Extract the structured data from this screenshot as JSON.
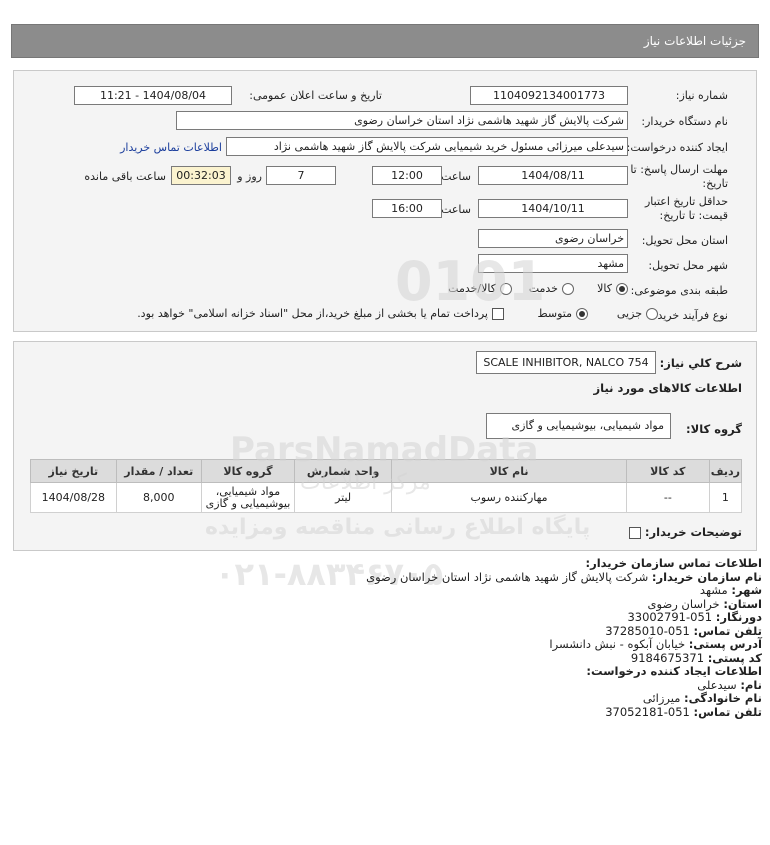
{
  "header": {
    "title": "جزئیات اطلاعات نیاز"
  },
  "form": {
    "need_number_label": "شماره نیاز:",
    "need_number": "1104092134001773",
    "announce_label": "تاریخ و ساعت اعلان عمومی:",
    "announce_value": "1404/08/04 - 11:21",
    "buyer_org_label": "نام دستگاه خریدار:",
    "buyer_org_value": "شرکت پالایش گاز شهید هاشمی نژاد   استان خراسان رضوی",
    "creator_label": "ایجاد کننده درخواست:",
    "creator_value": "سیدعلی میرزائی مسئول خرید شیمیایی شرکت پالایش گاز شهید هاشمی نژاد",
    "contact_link": "اطلاعات تماس خریدار",
    "deadline_label_1": "مهلت ارسال پاسخ: تا",
    "deadline_label_2": "تاریخ:",
    "deadline_date": "1404/08/11",
    "time_label": "ساعت",
    "deadline_time": "12:00",
    "days_value": "7",
    "days_label": "روز و",
    "remaining_value": "00:32:03",
    "remaining_label": "ساعت باقی مانده",
    "validity_label_1": "حداقل تاریخ اعتبار",
    "validity_label_2": "قیمت: تا تاریخ:",
    "validity_date": "1404/10/11",
    "validity_time": "16:00",
    "delivery_province_label": "استان محل تحویل:",
    "delivery_province": "خراسان رضوی",
    "delivery_city_label": "شهر محل تحویل:",
    "delivery_city": "مشهد",
    "category_label": "طبقه بندی موضوعی:",
    "category_options": [
      "کالا",
      "خدمت",
      "کالا/خدمت"
    ],
    "process_label": "نوع فرآیند خرید :",
    "process_options": [
      "جزیی",
      "متوسط"
    ],
    "payment_note": "پرداخت تمام یا بخشی از مبلغ خرید،از محل \"اسناد خزانه اسلامی\" خواهد بود."
  },
  "goods": {
    "summary_label": "شرح كلي نياز:",
    "summary_value": "SCALE INHIBITOR, NALCO 754",
    "section_title": "اطلاعات کالاهای مورد نیاز",
    "group_label": "گروه کالا:",
    "group_value": "مواد شیمیایی، بیوشیمیایی و گازی",
    "table_headers": [
      "ردیف",
      "کد کالا",
      "نام کالا",
      "واحد شمارش",
      "گروه کالا",
      "تعداد / مقدار",
      "تاریخ نیاز"
    ],
    "table_rows": [
      [
        "1",
        "--",
        "مهارکننده رسوب",
        "لیتر",
        "مواد شیمیایی، بیوشیمیایی و گازی",
        "8,000",
        "1404/08/28"
      ]
    ],
    "buyer_notes_label": "توضیحات خریدار:"
  },
  "contact": {
    "title": "اطلاعات تماس سازمان خریدار:",
    "org_label": "نام سازمان خریدار:",
    "org_value": "شرکت پالایش گاز شهید هاشمی نژاد استان خراسان رضوی",
    "city_label": "شهر:",
    "city_value": "مشهد",
    "province_label": "استان:",
    "province_value": "خراسان رضوی",
    "fax_label": "دورنگار:",
    "fax_value": "051-33002791",
    "phone_label": "تلفن تماس:",
    "phone_value": "051-37285010",
    "address_label": "آدرس پستی:",
    "address_value": "خیابان آبکوه - نبش دانشسرا",
    "postal_label": "کد پستی:",
    "postal_value": "9184675371",
    "creator_title": "اطلاعات ایجاد کننده درخواست:",
    "name_label": "نام:",
    "name_value": "سیدعلی",
    "family_label": "نام خانوادگی:",
    "family_value": "میرزائی",
    "creator_phone_label": "تلفن تماس:",
    "creator_phone_value": "051-37052181"
  },
  "watermark": {
    "number": "0101",
    "brand": "ParsNamadData",
    "line1": "مرکز اطلاعات",
    "line2": "پایگاه اطلاع رسانی مناقصه ومزایده",
    "phone": "۰۲۱-۸۸۳۴۶۷۰۵"
  }
}
